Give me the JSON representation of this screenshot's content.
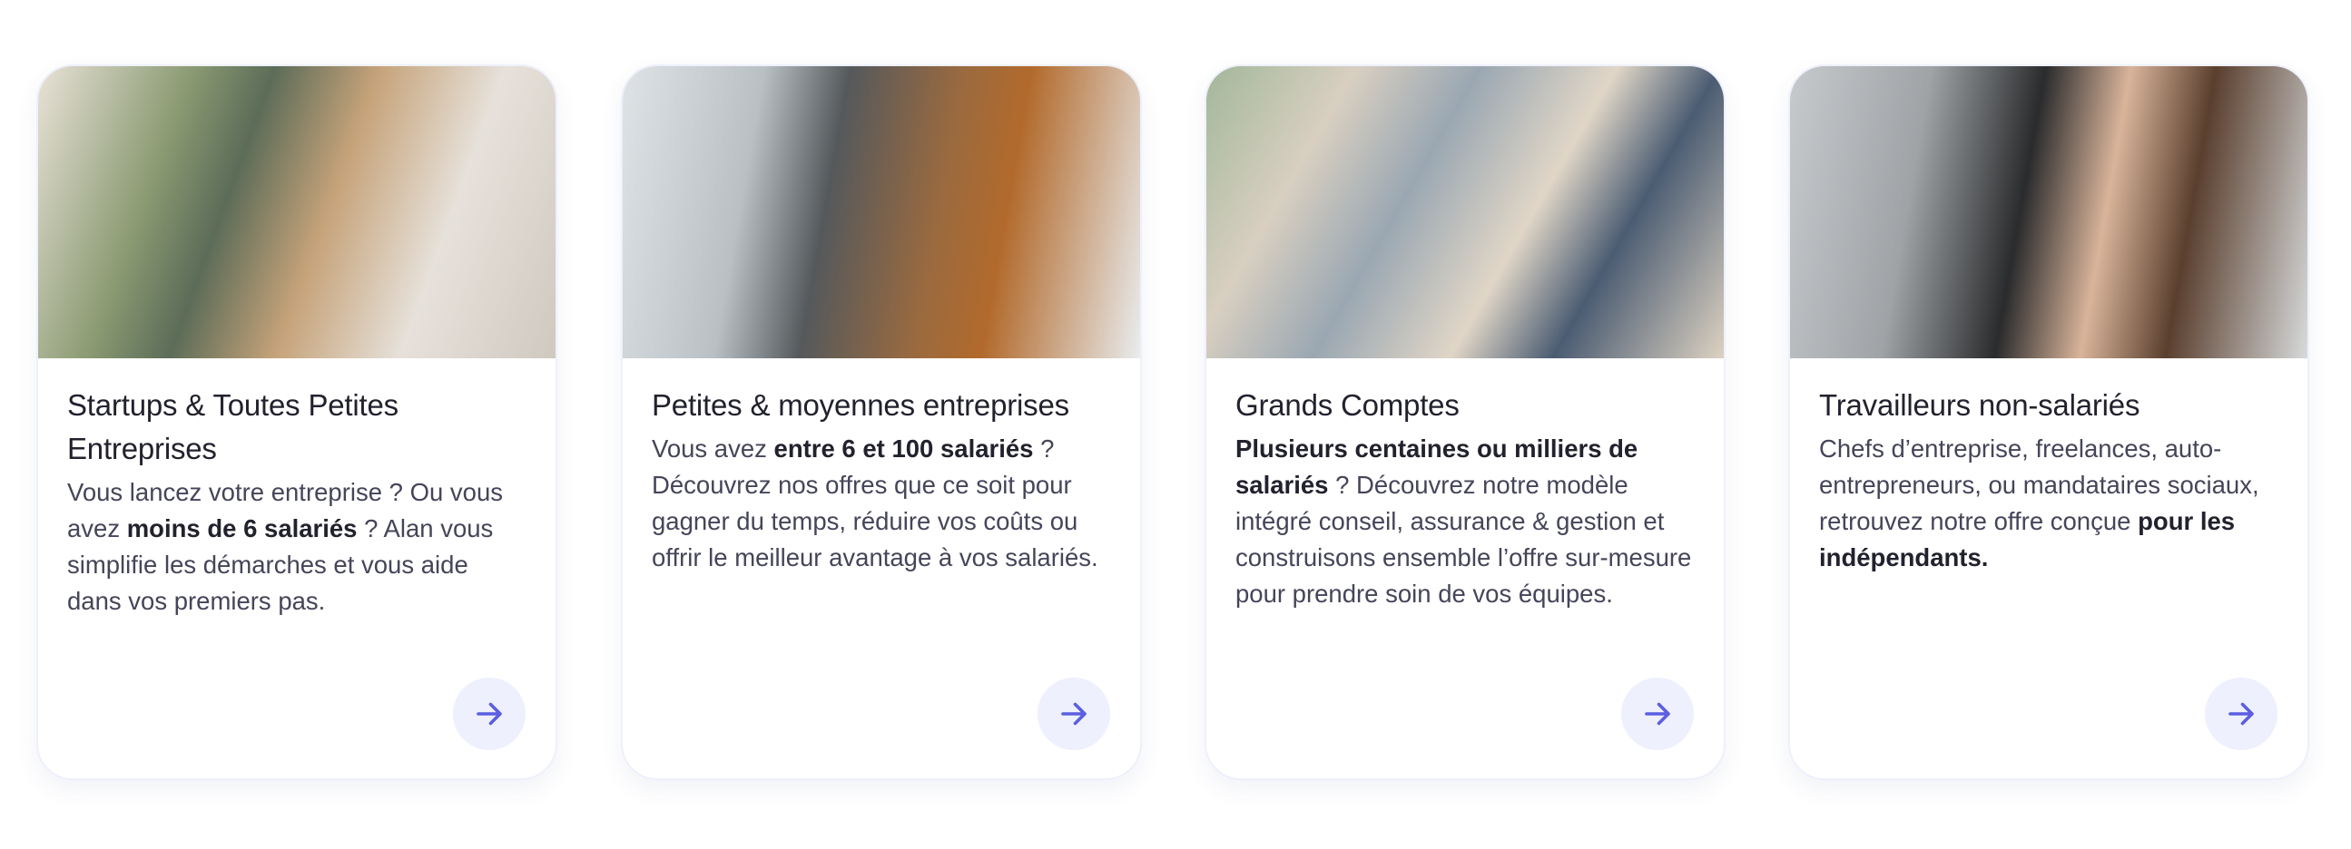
{
  "colors": {
    "accent": "#5b5fe0",
    "button_bg": "#eef0fe",
    "title": "#22222e",
    "text": "#45455a"
  },
  "cards": [
    {
      "title": "Startups & Toutes Petites Entreprises",
      "desc_pre": "Vous lancez votre entreprise ? Ou vous avez ",
      "desc_bold": "moins de 6 salariés",
      "desc_post": " ? Alan vous simplifie les démarches et vous aide dans vos premiers pas.",
      "icon": "arrow-right-icon"
    },
    {
      "title": "Petites & moyennes entreprises",
      "desc_pre": "Vous avez ",
      "desc_bold": "entre 6 et 100 salariés",
      "desc_post": " ? Découvrez nos offres que ce soit pour gagner du temps, réduire vos coûts ou offrir le meilleur avantage à vos salariés.",
      "icon": "arrow-right-icon"
    },
    {
      "title": "Grands Comptes",
      "desc_pre": "",
      "desc_bold": "Plusieurs centaines ou milliers de salariés",
      "desc_post": " ? Découvrez notre modèle intégré conseil, assurance & gestion et construisons ensemble l’offre sur-mesure pour prendre soin de vos équipes.",
      "icon": "arrow-right-icon"
    },
    {
      "title": "Travailleurs non-salariés",
      "desc_pre": "Chefs d’entreprise, freelances, auto-entrepreneurs, ou mandataires sociaux, retrouvez notre offre conçue ",
      "desc_bold": "pour les indépendants.",
      "desc_post": "",
      "icon": "arrow-right-icon"
    }
  ]
}
